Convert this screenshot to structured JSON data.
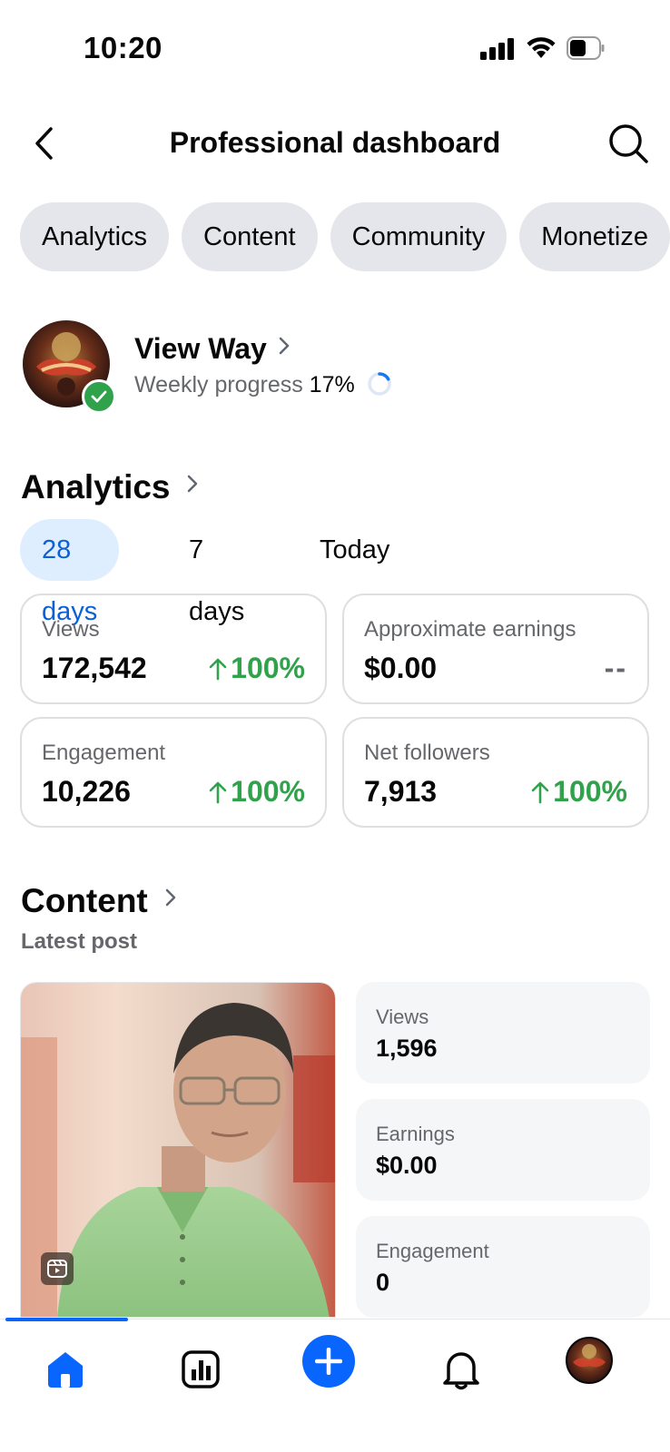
{
  "status_bar": {
    "time": "10:20"
  },
  "header": {
    "title": "Professional dashboard"
  },
  "tabs": [
    {
      "label": "Analytics"
    },
    {
      "label": "Content"
    },
    {
      "label": "Community"
    },
    {
      "label": "Monetize"
    }
  ],
  "profile": {
    "name": "View Way",
    "progress_label": "Weekly progress",
    "progress_percent_text": "17%",
    "progress_fraction": 0.17
  },
  "analytics": {
    "title": "Analytics",
    "periods": [
      {
        "label": "28 days",
        "selected": true
      },
      {
        "label": "7 days",
        "selected": false
      },
      {
        "label": "Today",
        "selected": false
      }
    ],
    "stats": [
      {
        "label": "Views",
        "value": "172,542",
        "change": "100%",
        "trend": "up"
      },
      {
        "label": "Approximate earnings",
        "value": "$0.00",
        "change": "--",
        "trend": "none"
      },
      {
        "label": "Engagement",
        "value": "10,226",
        "change": "100%",
        "trend": "up"
      },
      {
        "label": "Net followers",
        "value": "7,913",
        "change": "100%",
        "trend": "up"
      }
    ]
  },
  "content": {
    "title": "Content",
    "subtitle": "Latest post",
    "latest_post": {
      "metrics": [
        {
          "label": "Views",
          "value": "1,596"
        },
        {
          "label": "Earnings",
          "value": "$0.00"
        },
        {
          "label": "Engagement",
          "value": "0"
        }
      ]
    }
  },
  "bottom_nav": [
    {
      "icon": "home-icon",
      "active": true
    },
    {
      "icon": "insights-chart-icon",
      "active": false
    },
    {
      "icon": "create-plus-icon",
      "active": false
    },
    {
      "icon": "notifications-bell-icon",
      "active": false
    },
    {
      "icon": "profile-avatar-icon",
      "active": false
    }
  ],
  "colors": {
    "accent": "#0866ff",
    "positive": "#31a24c",
    "secondary_text": "#65676b",
    "chip_bg": "#e4e6eb"
  }
}
